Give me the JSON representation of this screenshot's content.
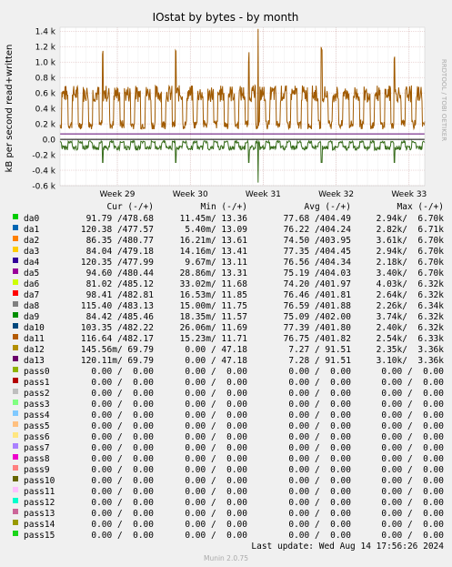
{
  "chart_data": {
    "type": "line",
    "title": "IOstat by bytes - by month",
    "ylabel": "kB per second read+written",
    "watermark": "RRDTOOL / TOBI OETIKER",
    "yticks": [
      "1.4 k",
      "1.2 k",
      "1.0 k",
      "0.8 k",
      "0.6 k",
      "0.4 k",
      "0.2 k",
      "0.0",
      "-0.2 k",
      "-0.4 k",
      "-0.6 k"
    ],
    "ylim": [
      -600,
      1450
    ],
    "xticks": [
      "Week 29",
      "Week 30",
      "Week 31",
      "Week 32",
      "Week 33"
    ],
    "x_range_days": [
      0,
      35
    ],
    "xtick_days": [
      5.5,
      12.5,
      19.5,
      26.5,
      33.5
    ],
    "colors": {
      "read_write_main": "#a05a00",
      "da12_line": "#5a0070",
      "neg_green": "#3a6e1e",
      "baseline": "#000000",
      "grid_major": "#d8b0b0",
      "grid_minor": "#ececec"
    },
    "series_summary": [
      {
        "name": "da11",
        "avg_pos": 482.17,
        "max_pos": 1430,
        "avg_neg": -75,
        "min_neg": -560
      }
    ],
    "legend_header": {
      "cur": "Cur (-/+)",
      "min": "Min (-/+)",
      "avg": "Avg (-/+)",
      "max": "Max (-/+)"
    },
    "legend": [
      {
        "name": "da0",
        "color": "#00cc00",
        "cur": "91.79 /478.68",
        "min": "11.45m/ 13.36",
        "avg": "77.68 /404.49",
        "max": "2.94k/  6.70k"
      },
      {
        "name": "da1",
        "color": "#0066b3",
        "cur": "120.38 /477.57",
        "min": "5.40m/ 13.09",
        "avg": "76.22 /404.24",
        "max": "2.82k/  6.71k"
      },
      {
        "name": "da2",
        "color": "#ff8000",
        "cur": "86.35 /480.77",
        "min": "16.21m/ 13.61",
        "avg": "74.50 /403.95",
        "max": "3.61k/  6.70k"
      },
      {
        "name": "da3",
        "color": "#ffcc00",
        "cur": "84.04 /479.18",
        "min": "14.16m/ 13.41",
        "avg": "77.35 /404.45",
        "max": "2.94k/  6.70k"
      },
      {
        "name": "da4",
        "color": "#330099",
        "cur": "120.35 /477.99",
        "min": "9.67m/ 13.11",
        "avg": "76.56 /404.34",
        "max": "2.18k/  6.70k"
      },
      {
        "name": "da5",
        "color": "#990099",
        "cur": "94.60 /480.44",
        "min": "28.86m/ 13.31",
        "avg": "75.19 /404.03",
        "max": "3.40k/  6.70k"
      },
      {
        "name": "da6",
        "color": "#ccff00",
        "cur": "81.02 /485.12",
        "min": "33.02m/ 11.68",
        "avg": "74.20 /401.97",
        "max": "4.03k/  6.32k"
      },
      {
        "name": "da7",
        "color": "#ff0000",
        "cur": "98.41 /482.81",
        "min": "16.53m/ 11.85",
        "avg": "76.46 /401.81",
        "max": "2.64k/  6.32k"
      },
      {
        "name": "da8",
        "color": "#808080",
        "cur": "115.40 /483.13",
        "min": "15.00m/ 11.75",
        "avg": "76.59 /401.88",
        "max": "2.26k/  6.34k"
      },
      {
        "name": "da9",
        "color": "#008f00",
        "cur": "84.42 /485.46",
        "min": "18.35m/ 11.57",
        "avg": "75.09 /402.00",
        "max": "3.74k/  6.32k"
      },
      {
        "name": "da10",
        "color": "#00487d",
        "cur": "103.35 /482.22",
        "min": "26.06m/ 11.69",
        "avg": "77.39 /401.80",
        "max": "2.40k/  6.32k"
      },
      {
        "name": "da11",
        "color": "#b35a00",
        "cur": "116.64 /482.17",
        "min": "15.23m/ 11.71",
        "avg": "76.75 /401.82",
        "max": "2.54k/  6.33k"
      },
      {
        "name": "da12",
        "color": "#b38f00",
        "cur": "145.56m/ 69.79",
        "min": "0.00 / 47.18",
        "avg": "7.27 / 91.51",
        "max": "2.35k/  3.36k"
      },
      {
        "name": "da13",
        "color": "#6b006b",
        "cur": "120.11m/ 69.79",
        "min": "0.00 / 47.18",
        "avg": "7.28 / 91.51",
        "max": "3.10k/  3.36k"
      },
      {
        "name": "pass0",
        "color": "#8fb300",
        "cur": "0.00 /  0.00",
        "min": "0.00 /  0.00",
        "avg": "0.00 /  0.00",
        "max": "0.00 /  0.00"
      },
      {
        "name": "pass1",
        "color": "#b30000",
        "cur": "0.00 /  0.00",
        "min": "0.00 /  0.00",
        "avg": "0.00 /  0.00",
        "max": "0.00 /  0.00"
      },
      {
        "name": "pass2",
        "color": "#bebebe",
        "cur": "0.00 /  0.00",
        "min": "0.00 /  0.00",
        "avg": "0.00 /  0.00",
        "max": "0.00 /  0.00"
      },
      {
        "name": "pass3",
        "color": "#80ff80",
        "cur": "0.00 /  0.00",
        "min": "0.00 /  0.00",
        "avg": "0.00 /  0.00",
        "max": "0.00 /  0.00"
      },
      {
        "name": "pass4",
        "color": "#80c9ff",
        "cur": "0.00 /  0.00",
        "min": "0.00 /  0.00",
        "avg": "0.00 /  0.00",
        "max": "0.00 /  0.00"
      },
      {
        "name": "pass5",
        "color": "#ffc080",
        "cur": "0.00 /  0.00",
        "min": "0.00 /  0.00",
        "avg": "0.00 /  0.00",
        "max": "0.00 /  0.00"
      },
      {
        "name": "pass6",
        "color": "#ffe680",
        "cur": "0.00 /  0.00",
        "min": "0.00 /  0.00",
        "avg": "0.00 /  0.00",
        "max": "0.00 /  0.00"
      },
      {
        "name": "pass7",
        "color": "#aa80ff",
        "cur": "0.00 /  0.00",
        "min": "0.00 /  0.00",
        "avg": "0.00 /  0.00",
        "max": "0.00 /  0.00"
      },
      {
        "name": "pass8",
        "color": "#ee00cc",
        "cur": "0.00 /  0.00",
        "min": "0.00 /  0.00",
        "avg": "0.00 /  0.00",
        "max": "0.00 /  0.00"
      },
      {
        "name": "pass9",
        "color": "#ff8080",
        "cur": "0.00 /  0.00",
        "min": "0.00 /  0.00",
        "avg": "0.00 /  0.00",
        "max": "0.00 /  0.00"
      },
      {
        "name": "pass10",
        "color": "#666600",
        "cur": "0.00 /  0.00",
        "min": "0.00 /  0.00",
        "avg": "0.00 /  0.00",
        "max": "0.00 /  0.00"
      },
      {
        "name": "pass11",
        "color": "#ffbfff",
        "cur": "0.00 /  0.00",
        "min": "0.00 /  0.00",
        "avg": "0.00 /  0.00",
        "max": "0.00 /  0.00"
      },
      {
        "name": "pass12",
        "color": "#00ffcc",
        "cur": "0.00 /  0.00",
        "min": "0.00 /  0.00",
        "avg": "0.00 /  0.00",
        "max": "0.00 /  0.00"
      },
      {
        "name": "pass13",
        "color": "#cc6699",
        "cur": "0.00 /  0.00",
        "min": "0.00 /  0.00",
        "avg": "0.00 /  0.00",
        "max": "0.00 /  0.00"
      },
      {
        "name": "pass14",
        "color": "#999900",
        "cur": "0.00 /  0.00",
        "min": "0.00 /  0.00",
        "avg": "0.00 /  0.00",
        "max": "0.00 /  0.00"
      },
      {
        "name": "pass15",
        "color": "#1ad51a",
        "cur": "0.00 /  0.00",
        "min": "0.00 /  0.00",
        "avg": "0.00 /  0.00",
        "max": "0.00 /  0.00"
      }
    ],
    "footer": {
      "last_update": "Last update: Wed Aug 14 17:56:26 2024",
      "version": "Munin 2.0.75"
    }
  }
}
